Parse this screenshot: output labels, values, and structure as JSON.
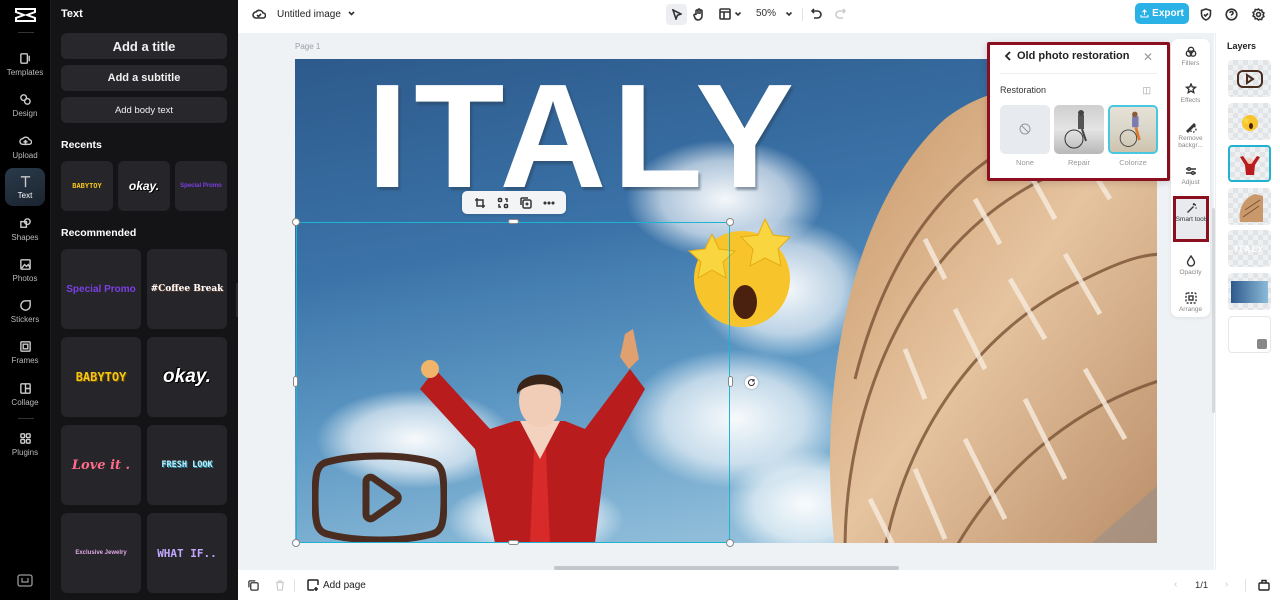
{
  "app": {
    "logo": "capcut-logo"
  },
  "rail": {
    "items": [
      {
        "label": "Templates",
        "icon": "templates-icon"
      },
      {
        "label": "Design",
        "icon": "design-icon"
      },
      {
        "label": "Upload",
        "icon": "upload-icon"
      },
      {
        "label": "Text",
        "icon": "text-icon",
        "active": true
      },
      {
        "label": "Shapes",
        "icon": "shapes-icon"
      },
      {
        "label": "Photos",
        "icon": "photos-icon"
      },
      {
        "label": "Stickers",
        "icon": "stickers-icon"
      },
      {
        "label": "Frames",
        "icon": "frames-icon"
      },
      {
        "label": "Collage",
        "icon": "collage-icon"
      },
      {
        "label": "Plugins",
        "icon": "plugins-icon"
      }
    ]
  },
  "panel": {
    "title": "Text",
    "add_title": "Add a title",
    "add_subtitle": "Add a subtitle",
    "add_body": "Add body text",
    "recents_heading": "Recents",
    "recents": [
      "BABYTOY",
      "okay.",
      "Special Promo"
    ],
    "recommended_heading": "Recommended",
    "recommended": [
      "Special Promo",
      "#Coffee Break",
      "BABYTOY",
      "okay.",
      "Love it .",
      "FRESH LOOK",
      "Exclusive Jewelry",
      "WHAT IF.."
    ]
  },
  "topbar": {
    "doc_title": "Untitled image",
    "zoom": "50%",
    "export_label": "Export"
  },
  "canvas": {
    "page_label": "Page 1",
    "headline": "ITALY"
  },
  "restoration_popup": {
    "title": "Old photo restoration",
    "section": "Restoration",
    "options": [
      {
        "label": "None",
        "selected": false
      },
      {
        "label": "Repair",
        "selected": false
      },
      {
        "label": "Colorize",
        "selected": true
      }
    ]
  },
  "side_tools": [
    {
      "label": "Filters"
    },
    {
      "label": "Effects"
    },
    {
      "label": "Remove backgr..."
    },
    {
      "label": "Adjust"
    },
    {
      "label": "Smart tools",
      "active": true
    },
    {
      "label": "Opacity"
    },
    {
      "label": "Arrange"
    }
  ],
  "layers": {
    "heading": "Layers",
    "items": [
      "video-play-shape",
      "star-eyes-emoji",
      "man-in-red-suit",
      "pisa-tower",
      "ITALY text",
      "sky background",
      "blank background"
    ],
    "selected_index": 2
  },
  "bottombar": {
    "add_page": "Add page",
    "page_indicator": "1/1"
  },
  "colors": {
    "accent": "#2ab1e5",
    "selection": "#1fb3d1",
    "highlight_box": "#8b0f1f"
  }
}
